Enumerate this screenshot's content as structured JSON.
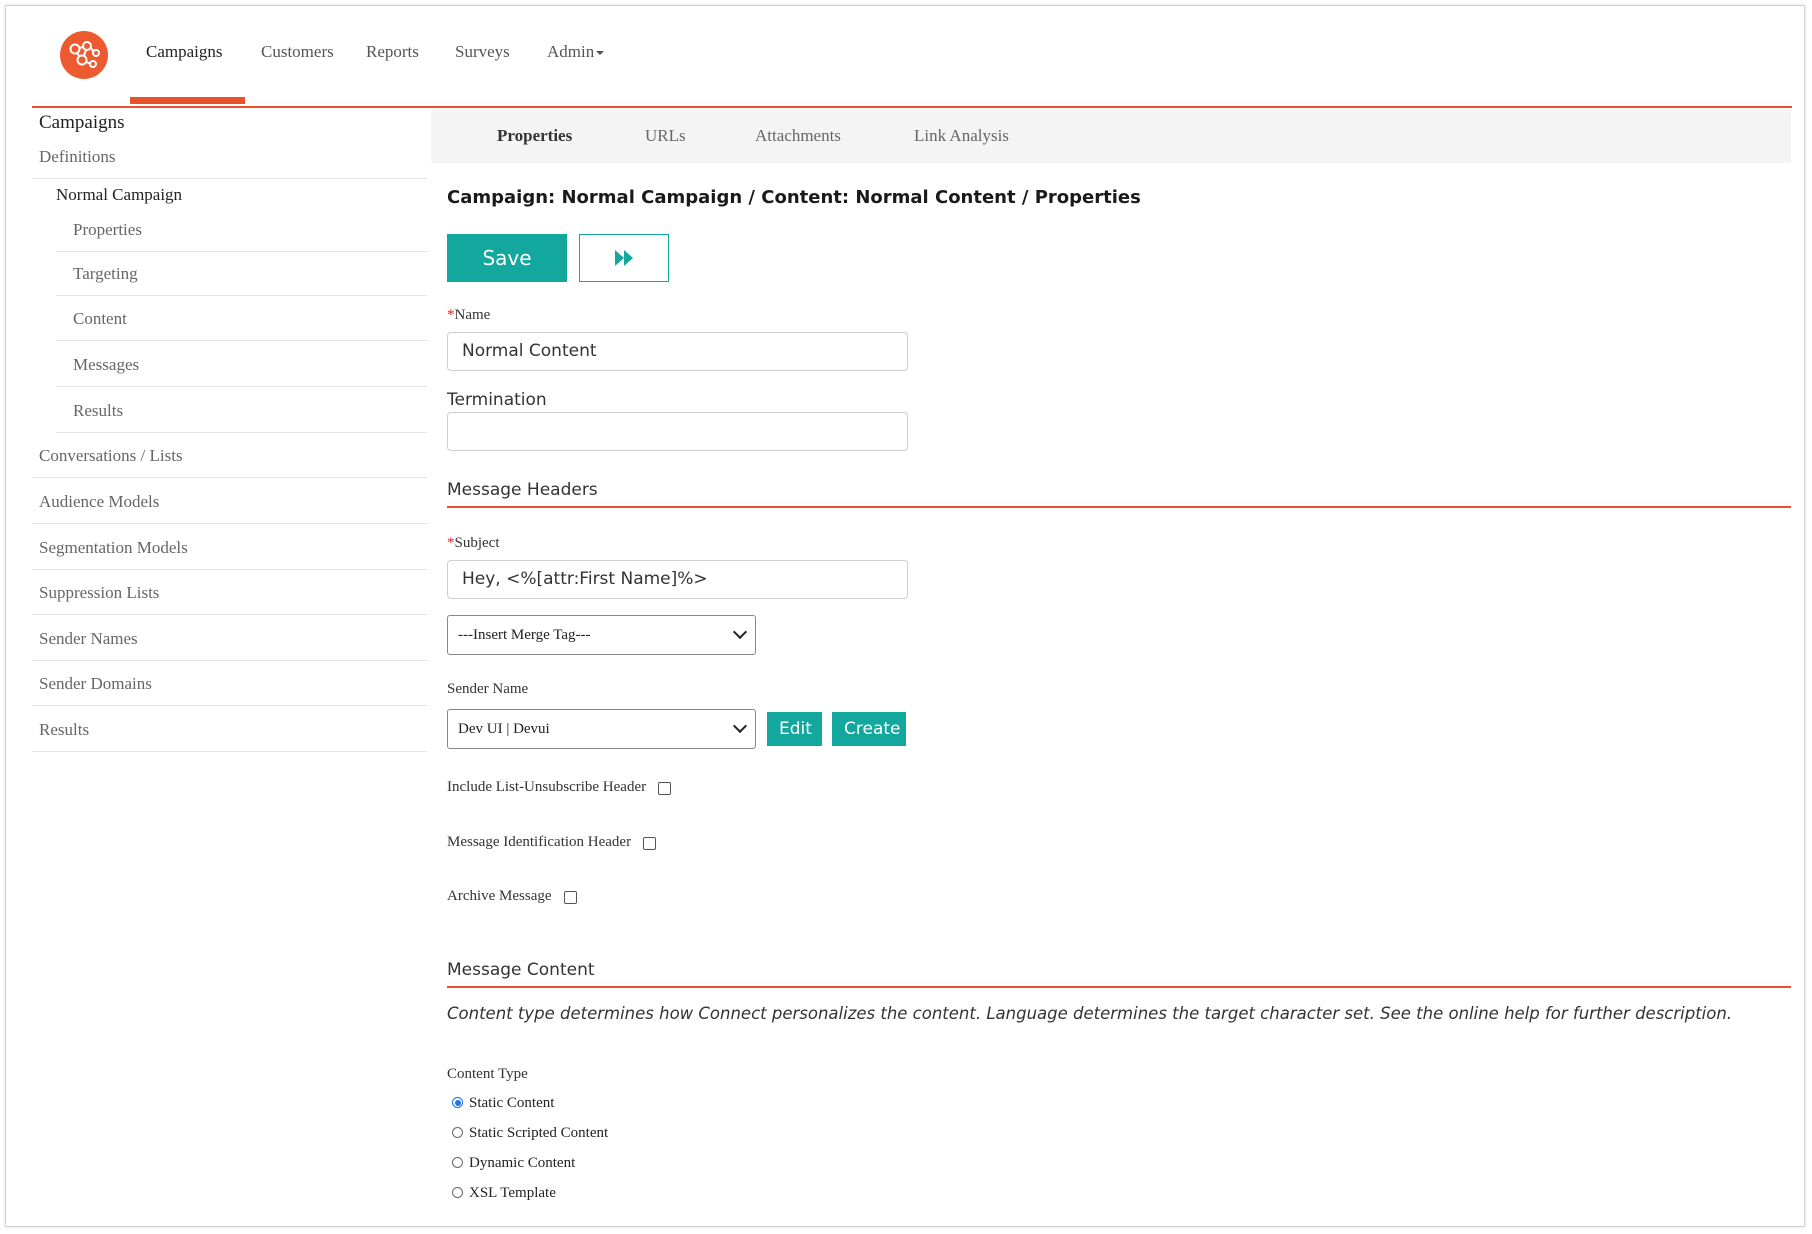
{
  "nav": {
    "items": [
      "Campaigns",
      "Customers",
      "Reports",
      "Surveys",
      "Admin"
    ],
    "active": "Campaigns"
  },
  "sidebar": {
    "title": "Campaigns",
    "items": [
      "Definitions",
      "Normal Campaign",
      "Properties",
      "Targeting",
      "Content",
      "Messages",
      "Results",
      "Conversations / Lists",
      "Audience Models",
      "Segmentation Models",
      "Suppression Lists",
      "Sender Names",
      "Sender Domains",
      "Results"
    ]
  },
  "tabs": [
    "Properties",
    "URLs",
    "Attachments",
    "Link Analysis"
  ],
  "breadcrumb": "Campaign: Normal Campaign / Content: Normal Content / Properties",
  "toolbar": {
    "save_label": "Save"
  },
  "form": {
    "required_mark": "*",
    "name_label": "Name",
    "name_value": "Normal Content",
    "termination_label": "Termination",
    "termination_value": "",
    "headers_title": "Message Headers",
    "subject_label": "Subject",
    "subject_value": "Hey, <%[attr:First Name]%>",
    "merge_tag_value": "---Insert Merge Tag---",
    "sender_label": "Sender Name",
    "sender_value": "Dev UI | Devui",
    "edit_label": "Edit",
    "create_label": "Create",
    "list_unsub_label": "Include List-Unsubscribe Header",
    "msg_id_label": "Message Identification Header",
    "archive_label": "Archive Message",
    "content_title": "Message Content",
    "content_desc": "Content type determines how Connect personalizes the content. Language determines the target character set. See the online help for further description.",
    "content_type_label": "Content Type",
    "content_types": [
      "Static Content",
      "Static Scripted Content",
      "Dynamic Content",
      "XSL Template"
    ],
    "content_type_selected": "Static Content"
  },
  "colors": {
    "accent": "#e8522a",
    "button": "#13a89e"
  }
}
